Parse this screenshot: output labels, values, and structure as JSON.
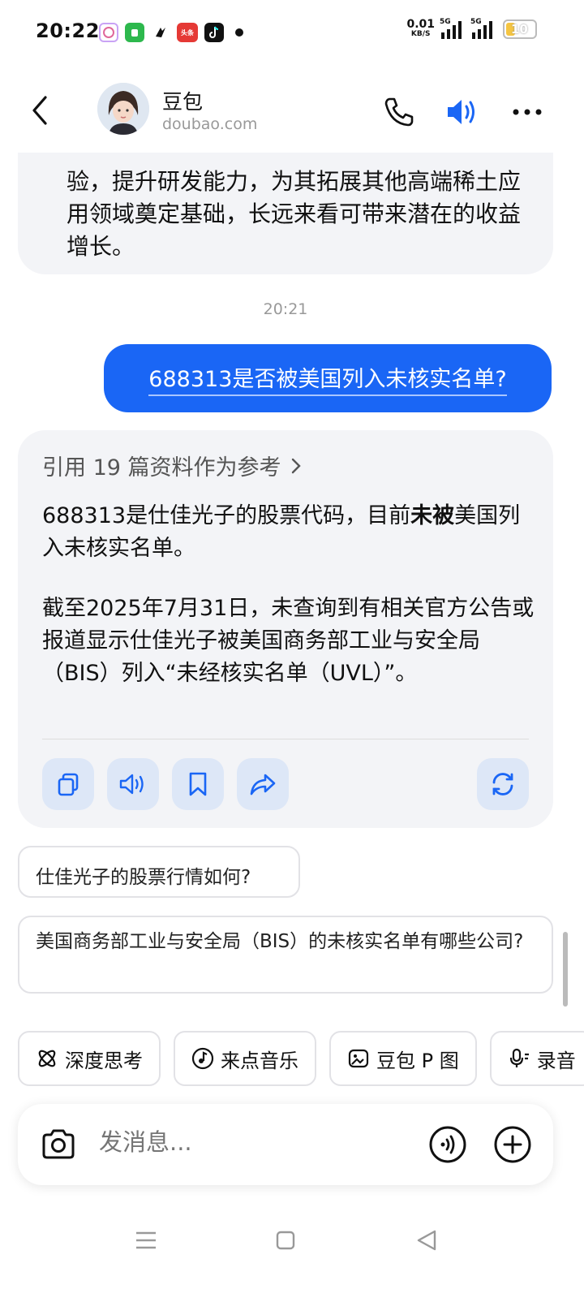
{
  "status_bar": {
    "time": "20:22",
    "apps": [
      "app-icon-1",
      "app-icon-2",
      "app-icon-3",
      "头条",
      "tiktok-icon"
    ],
    "net_speed": "0.01",
    "net_unit": "KB/S",
    "sim1": "5G",
    "sim2": "5G",
    "battery": "10"
  },
  "header": {
    "name": "豆包",
    "domain": "doubao.com"
  },
  "chat": {
    "prev_answer": "验，提升研发能力，为其拓展其他高端稀土应用领域奠定基础，长远来看可带来潜在的收益增长。",
    "timestamp": "20:21",
    "user_message": "688313是否被美国列入未核实名单?",
    "references": "引用 19 篇资料作为参考",
    "answer_p1_pre": "688313是仕佳光子的股票代码，目前",
    "answer_p1_bold": "未被",
    "answer_p1_post": "美国列入未核实名单。",
    "answer_p2": "截至2025年7月31日，未查询到有相关官方公告或报道显示仕佳光子被美国商务部工业与安全局（BIS）列入“未经核实名单（UVL）”。"
  },
  "suggestions": [
    "仕佳光子的股票行情如何?",
    "美国商务部工业与安全局（BIS）的未核实名单有哪些公司?"
  ],
  "chips": [
    "深度思考",
    "来点音乐",
    "豆包 P 图",
    "录音"
  ],
  "input": {
    "placeholder": "发消息..."
  },
  "colors": {
    "accent": "#1a66f5",
    "bubble": "#f3f4f7",
    "action_bg": "#dde7f7"
  }
}
